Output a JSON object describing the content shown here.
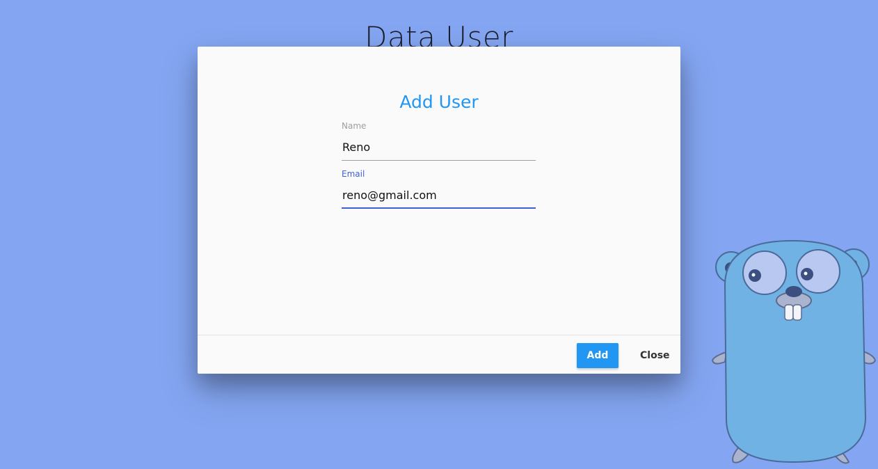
{
  "page": {
    "title": "Data User"
  },
  "modal": {
    "title": "Add User",
    "fields": {
      "name": {
        "label": "Name",
        "value": "Reno"
      },
      "email": {
        "label": "Email",
        "value": "reno@gmail.com"
      }
    },
    "buttons": {
      "add": "Add",
      "close": "Close"
    }
  },
  "colors": {
    "background": "#84a6f2",
    "accent": "#2196f3",
    "focus": "#3f5fd0",
    "gopher_body": "#71b2e4"
  },
  "icons": {
    "mascot": "gopher-mascot"
  }
}
